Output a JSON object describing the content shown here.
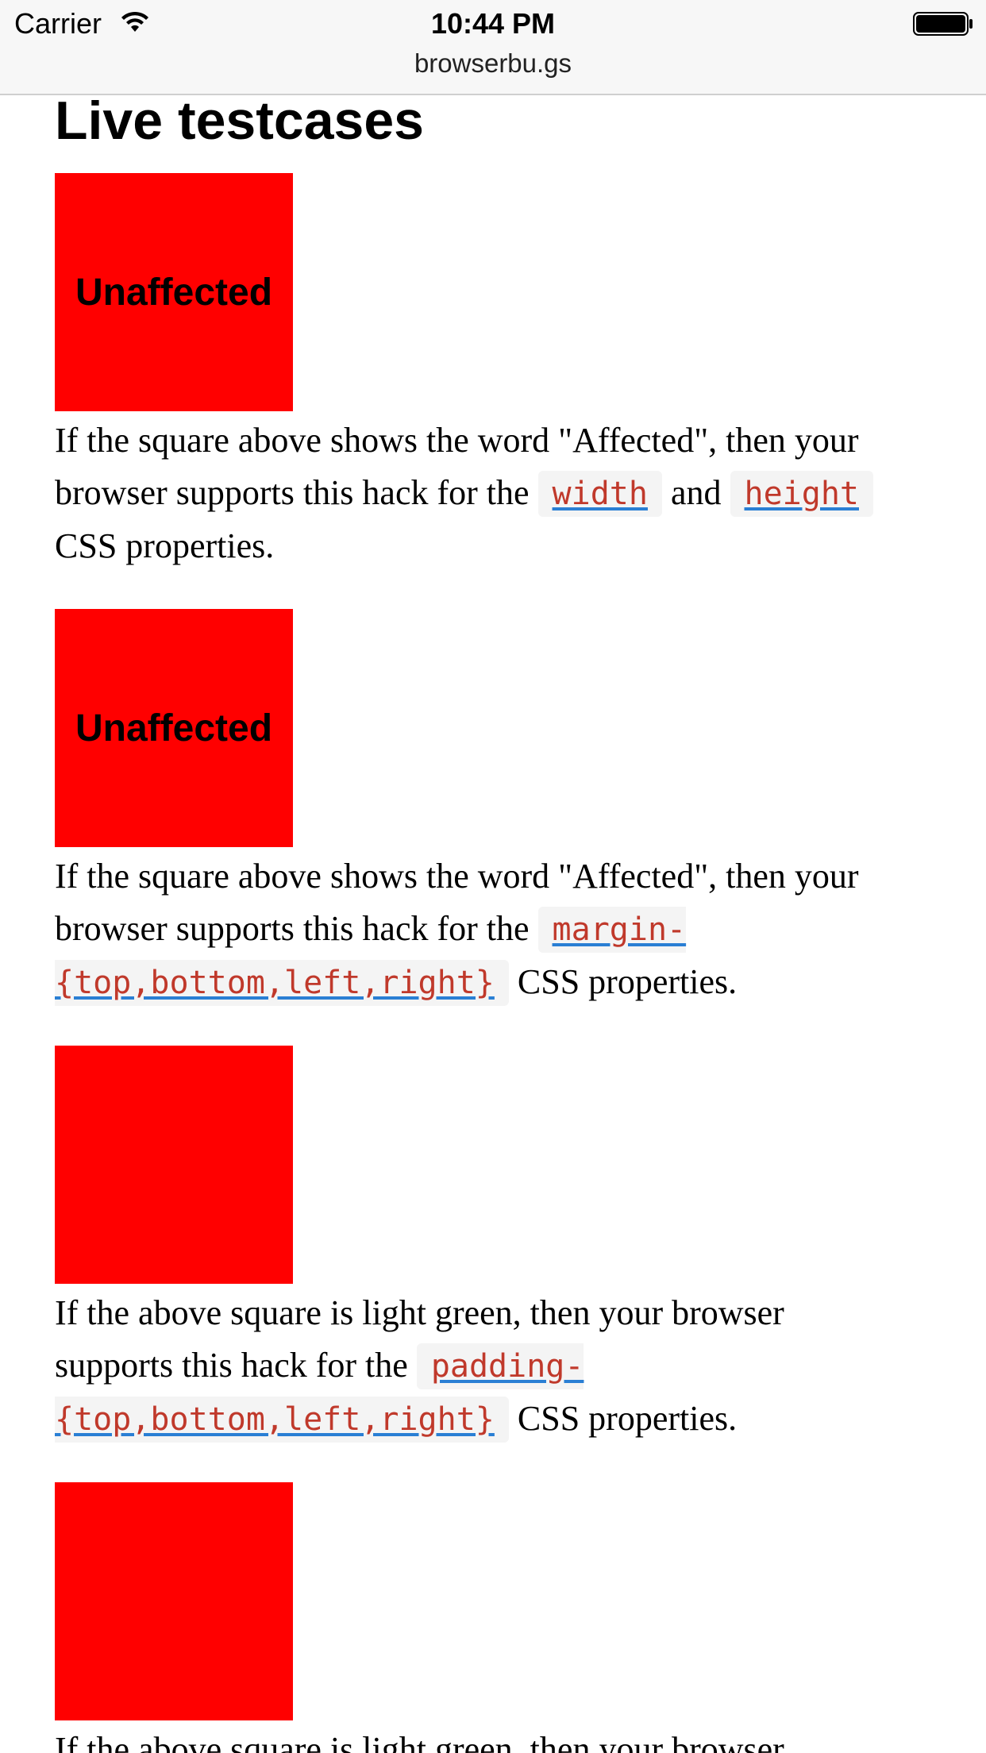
{
  "status_bar": {
    "carrier": "Carrier",
    "time": "10:44 PM",
    "url": "browserbu.gs"
  },
  "page": {
    "title": "Live testcases",
    "cases": [
      {
        "square_label": "Unaffected",
        "text_before": "If the square above shows the word \"Affected\", then your browser supports this hack for the ",
        "code_1": "width",
        "middle": " and ",
        "code_2": "height",
        "text_after": " CSS properties."
      },
      {
        "square_label": "Unaffected",
        "text_before": "If the square above shows the word \"Affected\", then your browser supports this hack for the ",
        "code_1": "margin-{top,bottom,left,right}",
        "text_after": " CSS properties."
      },
      {
        "square_label": "",
        "text_before": "If the above square is light green, then your browser supports this hack for the ",
        "code_1": "padding-{top,bottom,left,right}",
        "text_after": " CSS properties."
      },
      {
        "square_label": "",
        "text_before": "If the above square is light green, then your browser"
      }
    ]
  },
  "colors": {
    "square": "#ff0000",
    "code_text": "#c0392b",
    "link_underline": "#2a7fd4"
  },
  "icons": {
    "wifi": "wifi-icon",
    "battery": "battery-icon"
  }
}
